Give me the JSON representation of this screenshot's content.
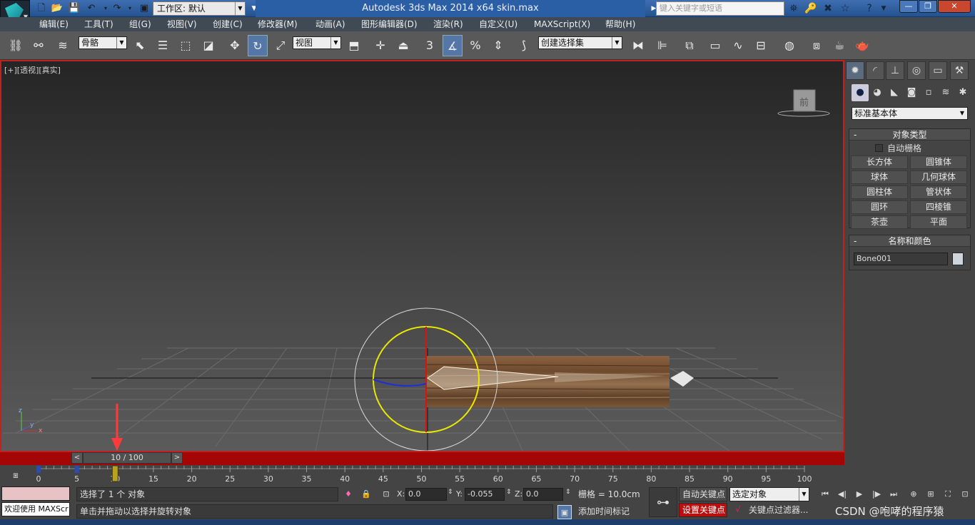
{
  "app": {
    "window_title": "Autodesk 3ds Max  2014 x64      skin.max",
    "workspace_label": "工作区: 默认",
    "help_search_placeholder": "键入关键字或短语"
  },
  "menus": [
    "编辑(E)",
    "工具(T)",
    "组(G)",
    "视图(V)",
    "创建(C)",
    "修改器(M)",
    "动画(A)",
    "图形编辑器(D)",
    "渲染(R)",
    "自定义(U)",
    "MAXScript(X)",
    "帮助(H)"
  ],
  "toolbar": {
    "selection_filter": "骨骼",
    "ref_coord": "视图",
    "named_selection": "创建选择集",
    "snap_angle": "3"
  },
  "viewport": {
    "label": "[+][透视][真实]",
    "viewcube_label": "前",
    "axis_labels": {
      "x": "x",
      "y": "y",
      "z": "z"
    }
  },
  "command_panel": {
    "primitive_type": "标准基本体",
    "object_type": {
      "title": "对象类型",
      "autogrid": "自动栅格",
      "buttons": [
        "长方体",
        "圆锥体",
        "球体",
        "几何球体",
        "圆柱体",
        "管状体",
        "圆环",
        "四棱锥",
        "茶壶",
        "平面"
      ]
    },
    "name_color": {
      "title": "名称和颜色",
      "name": "Bone001",
      "color": "#cfd3dc"
    }
  },
  "timeline": {
    "current": 10,
    "end": 100,
    "slider_text": "10 / 100",
    "ticks": [
      0,
      5,
      10,
      15,
      20,
      25,
      30,
      35,
      40,
      45,
      50,
      55,
      60,
      65,
      70,
      75,
      80,
      85,
      90,
      95,
      100
    ]
  },
  "status": {
    "welcome": "欢迎使用 MAXScr",
    "selection_text": "选择了 1 个 对象",
    "prompt_text": "单击并拖动以选择并旋转对象",
    "x": "0.0",
    "y": "-0.055",
    "z": "0.0",
    "x_label": "X:",
    "y_label": "Y:",
    "z_label": "Z:",
    "grid": "栅格 = 10.0cm",
    "add_time_tag": "添加时间标记",
    "auto_key": "自动关键点",
    "set_key": "设置关键点",
    "key_mode": "选定对象",
    "key_filters": "关键点过滤器...",
    "watermark": "CSDN @咆哮的程序猿"
  },
  "colors": {
    "viewport_border": "#c42020",
    "timebar": "#a40505",
    "accent": "#5577a8",
    "gizmo_ring": "#e8e800",
    "set_key_bg": "#b81010"
  }
}
